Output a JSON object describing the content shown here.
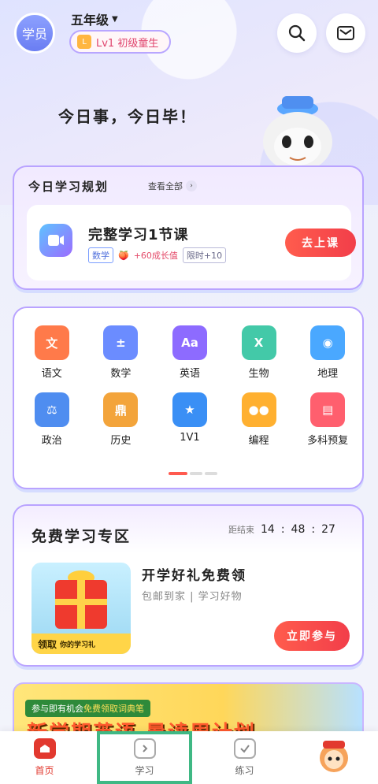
{
  "header": {
    "avatar_label": "学员",
    "grade": "五年级",
    "level": "Lv1 初级童生",
    "level_icon_text": "L"
  },
  "slogan": "今日事，今日毕！",
  "plan": {
    "title": "今日学习规划",
    "view_all": "查看全部",
    "lesson": {
      "name": "完整学习1节课",
      "subject_tag": "数学",
      "reward": "+60成长值",
      "time_tag": "限时+10",
      "action": "去上课"
    }
  },
  "subjects": [
    {
      "label": "语文",
      "icon": "palace-icon",
      "color": "#ff7a4a",
      "glyph": "文"
    },
    {
      "label": "数学",
      "icon": "calculator-icon",
      "color": "#6b8cff",
      "glyph": "±"
    },
    {
      "label": "英语",
      "icon": "laptop-aa-icon",
      "color": "#8d6bff",
      "glyph": "Aa"
    },
    {
      "label": "生物",
      "icon": "dna-icon",
      "color": "#43c9a8",
      "glyph": "X"
    },
    {
      "label": "地理",
      "icon": "planet-icon",
      "color": "#4aa8ff",
      "glyph": "◉"
    },
    {
      "label": "政治",
      "icon": "gavel-icon",
      "color": "#4f8df0",
      "glyph": "⚖"
    },
    {
      "label": "历史",
      "icon": "bronze-vessel-icon",
      "color": "#f3a43b",
      "glyph": "鼎"
    },
    {
      "label": "1V1",
      "icon": "star-icon",
      "color": "#3a8ff5",
      "glyph": "★"
    },
    {
      "label": "编程",
      "icon": "robot-icon",
      "color": "#ffb030",
      "glyph": "●●"
    },
    {
      "label": "多科预复",
      "icon": "folder-icon",
      "color": "#ff5f6e",
      "glyph": "▤"
    }
  ],
  "free_zone": {
    "title": "免费学习专区",
    "countdown_label": "距结束",
    "countdown": [
      "14",
      "48",
      "27"
    ],
    "gift_caption": "领取",
    "gift_caption_small": "你的学习礼",
    "promo_title": "开学好礼免费领",
    "promo_sub": "包邮到家 | 学习好物",
    "action": "立即参与"
  },
  "banner": {
    "tag_pre": "参与即有机会",
    "tag_highlight": "免费领取词典笔",
    "headline": "新学期英语 暑读周计划"
  },
  "tabbar": [
    {
      "label": "首页",
      "icon": "home-icon"
    },
    {
      "label": "学习",
      "icon": "study-icon"
    },
    {
      "label": "练习",
      "icon": "practice-icon"
    },
    {
      "label": "",
      "icon": "mascot-icon"
    }
  ],
  "colors": {
    "accent": "#f23e4a",
    "border": "#b9a3ff",
    "highlight_box": "#3fb884"
  }
}
